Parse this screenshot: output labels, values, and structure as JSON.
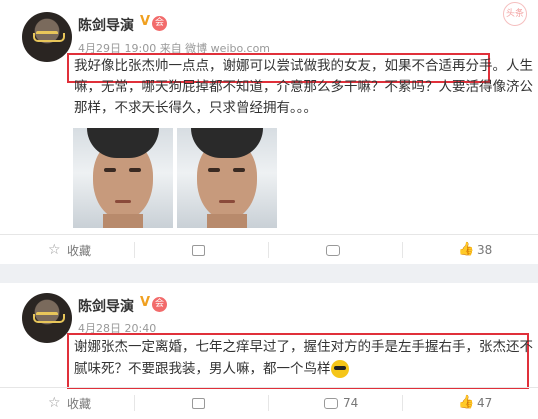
{
  "posts": [
    {
      "author": "陈剑导演",
      "verified_badge": "V",
      "member_badge": "会",
      "meta": "4月29日 19:00 来自 微博 weibo.com",
      "text_lines": [
        "我好像比张杰帅一点点，谢娜可以尝试做我的女友，如果不合适再分手。人生",
        "嘛，无常，哪天狗屁掉都不知道，介意那么多干嘛？不累吗？人要活得像济公",
        "那样，不求天长得久，只求曾经拥有。。。"
      ],
      "highlight_color": "#e0303a",
      "actions": {
        "favorite": "收藏",
        "share_count": "",
        "comment_count": "",
        "like_count": "38"
      }
    },
    {
      "author": "陈剑导演",
      "verified_badge": "V",
      "member_badge": "会",
      "meta": "4月28日 20:40",
      "text_lines": [
        "谢娜张杰一定离婚，七年之痒早过了，握住对方的手是左手握右手，张杰还不",
        "腻味死？不要跟我装，男人嘛，都一个鸟样"
      ],
      "actions": {
        "favorite": "收藏",
        "share_count": "",
        "comment_count": "74",
        "like_count": "47"
      }
    }
  ],
  "watermark": "头条",
  "icons": [
    "star-icon",
    "share-icon",
    "comment-icon",
    "like-icon",
    "cool-emoji-icon"
  ]
}
